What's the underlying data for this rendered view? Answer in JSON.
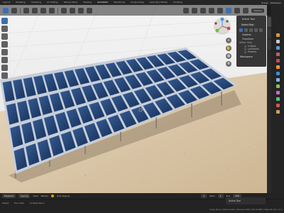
{
  "topbar": {
    "tabs": [
      "Layout",
      "Modeling",
      "Sculpting",
      "UV Editing",
      "Texture Paint",
      "Shading",
      "Animation",
      "Rendering",
      "Compositing",
      "Geometry Nodes",
      "Scripting"
    ],
    "scene_label": "Scene",
    "view_layer_label": "ViewLayer"
  },
  "viewport_header": {
    "options_label": "Options"
  },
  "npanel": {
    "active_tool_header": "Active Tool",
    "tool_name": "Select Box",
    "options_header": "Options",
    "transform_label": "Transform",
    "affect_only_label": "Affect Only",
    "affect_origins": "Origins",
    "affect_locations": "Locations",
    "affect_parents": "Parents",
    "workspace_header": "Workspace"
  },
  "timeline": {
    "playback_label": "Playback",
    "keying_label": "Keying",
    "view_label": "View",
    "marker_label": "Marker",
    "auto_keying_label": "Auto Keying",
    "start_label": "Start",
    "start_value": "1",
    "end_label": "End",
    "end_value": "250",
    "current_frame": "1"
  },
  "statusbar": {
    "select_hint": "Select",
    "pan_hint": "Pan View",
    "context_hint": "Context Menu",
    "stats": "Solar_Row | Verts:2,400 | Faces:2,184 | Tris:4,368 | Objects:1/3 | 3.3"
  },
  "active_tool_popup": {
    "label": "Active Tool"
  },
  "colors": {
    "accent": "#3e6eb0",
    "panel_blue": "#1e3a66",
    "panel_frame": "#c8ced8",
    "ground": "#d8c4a6",
    "background": "#ececec"
  },
  "icons": {
    "gizmo": "navigation-gizmo-icon",
    "zoom": "zoom-icon",
    "pan": "pan-hand-icon",
    "camera": "camera-icon",
    "ortho": "grid-icon",
    "cursor": "select-cursor-icon"
  },
  "solar_panel": {
    "columns": 18,
    "rows": 4
  }
}
